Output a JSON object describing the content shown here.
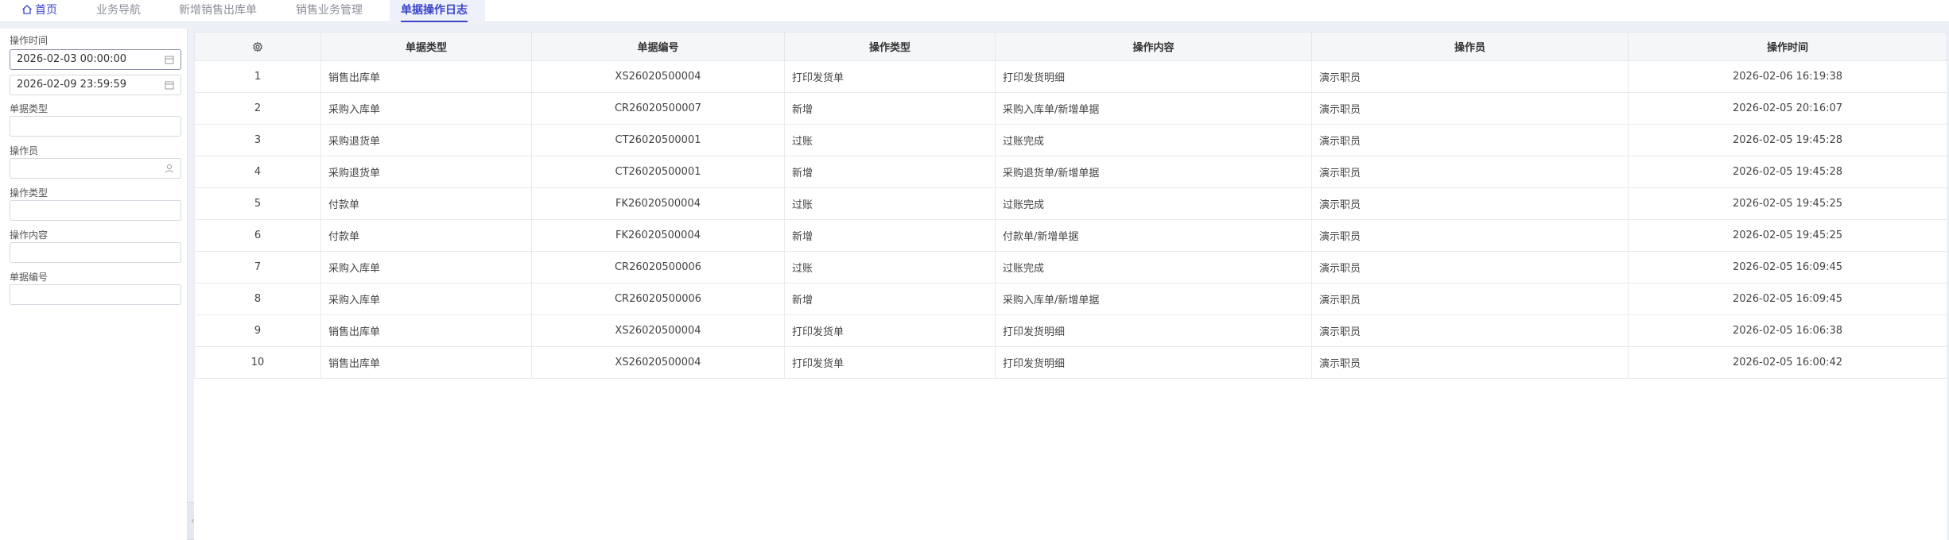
{
  "tabs": [
    {
      "label": "首页",
      "icon": "home-icon"
    },
    {
      "label": "业务导航"
    },
    {
      "label": "新增销售出库单"
    },
    {
      "label": "销售业务管理"
    },
    {
      "label": "单据操作日志",
      "active": true
    }
  ],
  "filters": {
    "op_time_label": "操作时间",
    "op_time_start": "2026-02-03 00:00:00",
    "op_time_end": "2026-02-09 23:59:59",
    "doc_type_label": "单据类型",
    "operator_label": "操作员",
    "op_type_label": "操作类型",
    "op_content_label": "操作内容",
    "doc_no_label": "单据编号"
  },
  "table": {
    "settings_icon": "gear-icon",
    "columns": [
      "单据类型",
      "单据编号",
      "操作类型",
      "操作内容",
      "操作员",
      "操作时间"
    ],
    "rows": [
      {
        "idx": "1",
        "doc_type": "销售出库单",
        "doc_no": "XS26020500004",
        "op_type": "打印发货单",
        "content": "打印发货明细",
        "operator": "演示职员",
        "time": "2026-02-06 16:19:38"
      },
      {
        "idx": "2",
        "doc_type": "采购入库单",
        "doc_no": "CR26020500007",
        "op_type": "新增",
        "content": "采购入库单/新增单据",
        "operator": "演示职员",
        "time": "2026-02-05 20:16:07"
      },
      {
        "idx": "3",
        "doc_type": "采购退货单",
        "doc_no": "CT26020500001",
        "op_type": "过账",
        "content": "过账完成",
        "operator": "演示职员",
        "time": "2026-02-05 19:45:28"
      },
      {
        "idx": "4",
        "doc_type": "采购退货单",
        "doc_no": "CT26020500001",
        "op_type": "新增",
        "content": "采购退货单/新增单据",
        "operator": "演示职员",
        "time": "2026-02-05 19:45:28"
      },
      {
        "idx": "5",
        "doc_type": "付款单",
        "doc_no": "FK26020500004",
        "op_type": "过账",
        "content": "过账完成",
        "operator": "演示职员",
        "time": "2026-02-05 19:45:25"
      },
      {
        "idx": "6",
        "doc_type": "付款单",
        "doc_no": "FK26020500004",
        "op_type": "新增",
        "content": "付款单/新增单据",
        "operator": "演示职员",
        "time": "2026-02-05 19:45:25"
      },
      {
        "idx": "7",
        "doc_type": "采购入库单",
        "doc_no": "CR26020500006",
        "op_type": "过账",
        "content": "过账完成",
        "operator": "演示职员",
        "time": "2026-02-05 16:09:45"
      },
      {
        "idx": "8",
        "doc_type": "采购入库单",
        "doc_no": "CR26020500006",
        "op_type": "新增",
        "content": "采购入库单/新增单据",
        "operator": "演示职员",
        "time": "2026-02-05 16:09:45"
      },
      {
        "idx": "9",
        "doc_type": "销售出库单",
        "doc_no": "XS26020500004",
        "op_type": "打印发货单",
        "content": "打印发货明细",
        "operator": "演示职员",
        "time": "2026-02-05 16:06:38"
      },
      {
        "idx": "10",
        "doc_type": "销售出库单",
        "doc_no": "XS26020500004",
        "op_type": "打印发货单",
        "content": "打印发货明细",
        "operator": "演示职员",
        "time": "2026-02-05 16:00:42"
      }
    ]
  },
  "colors": {
    "accent": "#3a45c8",
    "background": "#eef0f8"
  }
}
